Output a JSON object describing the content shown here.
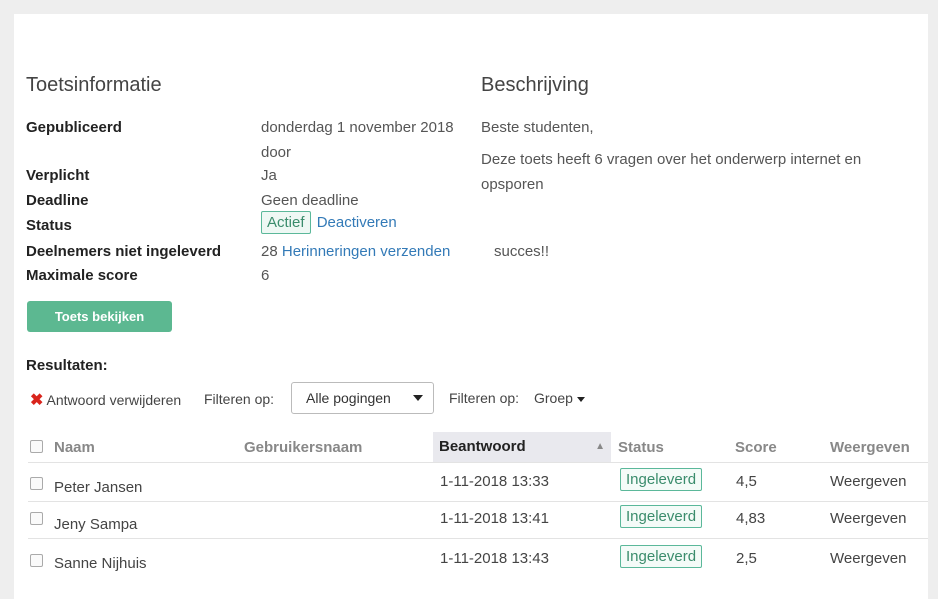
{
  "info": {
    "title": "Toetsinformatie",
    "published_label": "Gepubliceerd",
    "published_value": "donderdag 1 november 2018",
    "published_by": "door",
    "required_label": "Verplicht",
    "required_value": "Ja",
    "deadline_label": "Deadline",
    "deadline_value": "Geen deadline",
    "status_label": "Status",
    "status_value": "Actief",
    "deactivate_link": "Deactiveren",
    "not_submitted_label": "Deelnemers niet ingeleverd",
    "not_submitted_count": "28",
    "reminders_link": "Herinneringen verzenden",
    "max_score_label": "Maximale score",
    "max_score_value": "6",
    "view_test_button": "Toets bekijken"
  },
  "description": {
    "title": "Beschrijving",
    "greeting": "Beste studenten,",
    "line1": "Deze toets heeft 6 vragen over het onderwerp internet en",
    "line2": "opsporen",
    "closing": "succes!!"
  },
  "results": {
    "title": "Resultaten:",
    "delete_answer": "Antwoord verwijderen",
    "filter_label_1": "Filteren op:",
    "filter_select_value": "Alle pogingen",
    "filter_label_2": "Filteren op:",
    "group_dropdown": "Groep",
    "columns": {
      "name": "Naam",
      "username": "Gebruikersnaam",
      "answered": "Beantwoord",
      "status": "Status",
      "score": "Score",
      "view": "Weergeven"
    },
    "rows": [
      {
        "name": "Peter Jansen",
        "username": "",
        "answered": "1-11-2018 13:33",
        "status": "Ingeleverd",
        "score": "4,5",
        "view": "Weergeven"
      },
      {
        "name": "Jeny Sampa",
        "username": "",
        "answered": "1-11-2018 13:41",
        "status": "Ingeleverd",
        "score": "4,83",
        "view": "Weergeven"
      },
      {
        "name": "Sanne Nijhuis",
        "username": "",
        "answered": "1-11-2018 13:43",
        "status": "Ingeleverd",
        "score": "2,5",
        "view": "Weergeven"
      }
    ]
  },
  "colors": {
    "accent_green": "#5cb891",
    "link_blue": "#337ab7",
    "delete_red": "#d9241c"
  },
  "icons": {
    "delete": "close-icon",
    "sort": "sort-asc-icon",
    "select_caret": "chevron-down-icon",
    "group_caret": "caret-down-icon"
  }
}
